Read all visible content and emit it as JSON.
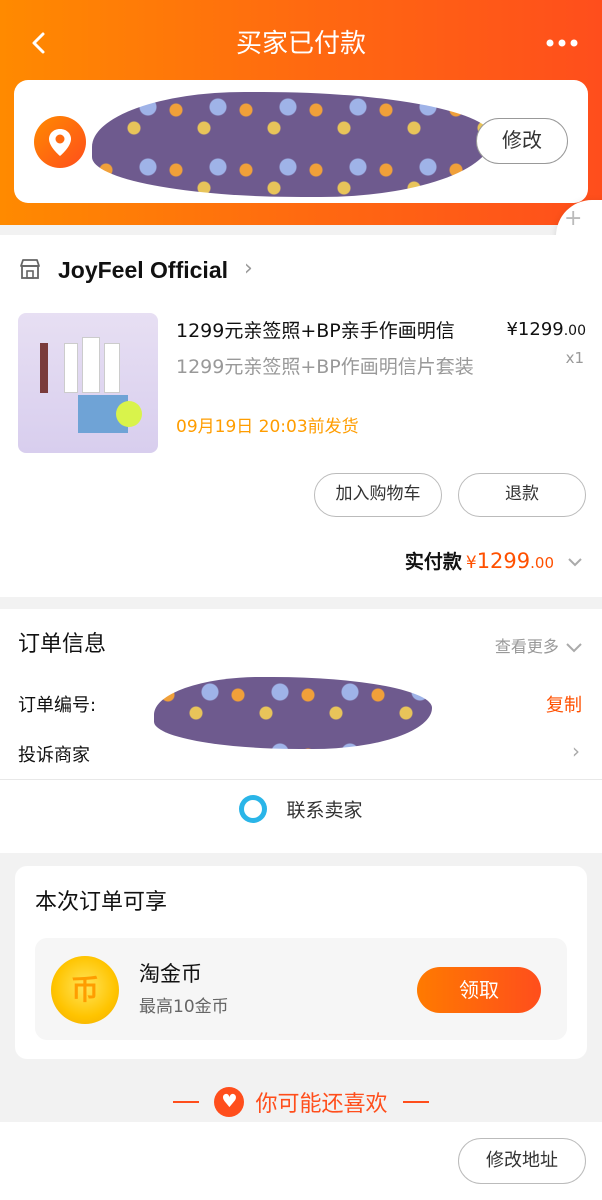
{
  "header": {
    "title": "买家已付款",
    "back_icon": "chevron-left-icon",
    "more_icon": "more-dots-icon"
  },
  "address": {
    "edit_label": "修改"
  },
  "shop": {
    "name": "JoyFeel Official"
  },
  "product": {
    "title": "1299元亲签照+BP亲手作画明信",
    "subtitle": "1299元亲签照+BP作画明信片套装",
    "ship_text": "09月19日 20:03前发货",
    "price_yen": "¥1299",
    "price_cents": ".00",
    "quantity": "x1",
    "cart_label": "加入购物车",
    "refund_label": "退款"
  },
  "payment": {
    "label": "实付款",
    "yen": "¥",
    "amount": "1299",
    "cents": ".00"
  },
  "order_info": {
    "title": "订单信息",
    "more_label": "查看更多",
    "order_no_label": "订单编号:",
    "copy_label": "复制",
    "complaint_label": "投诉商家",
    "contact_label": "联系卖家"
  },
  "benefits": {
    "title": "本次订单可享",
    "coin_name": "淘金币",
    "coin_desc": "最高10金币",
    "claim_label": "领取"
  },
  "recommend": {
    "label": "你可能还喜欢"
  },
  "bottom": {
    "edit_address_label": "修改地址"
  },
  "colors": {
    "brand_orange": "#ff5000",
    "ship_text": "#ff9d00"
  }
}
